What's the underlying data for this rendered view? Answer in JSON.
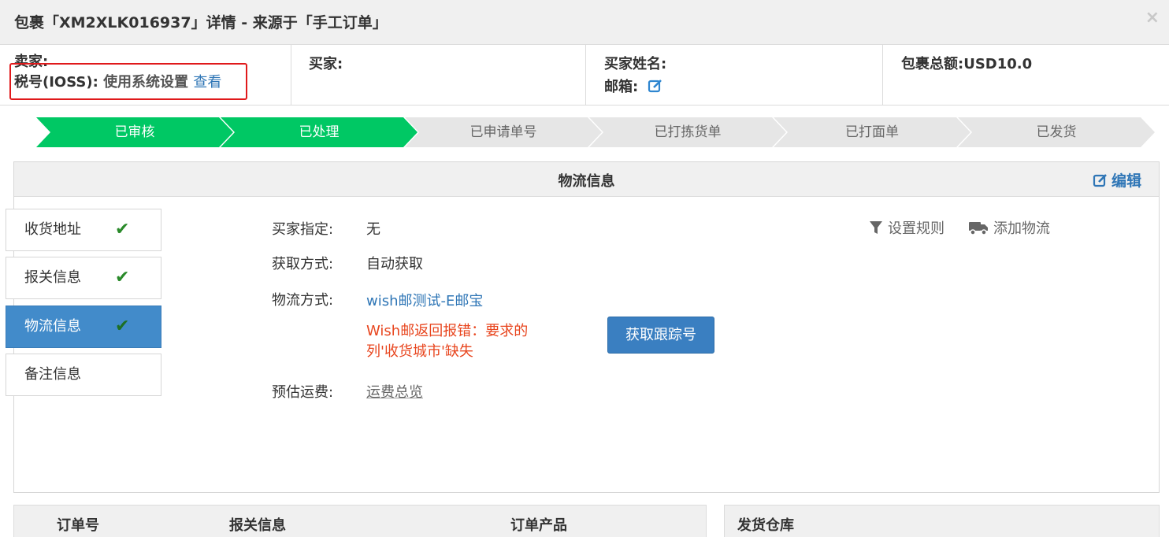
{
  "dialog": {
    "title": "包裹「XM2XLK016937」详情 - 来源于「手工订单」",
    "close_icon": "×"
  },
  "info": {
    "seller_label": "卖家:",
    "ioss_label": "税号(IOSS):",
    "ioss_value": "使用系统设置",
    "ioss_link": "查看",
    "buyer_label": "买家:",
    "buyer_name_label": "买家姓名:",
    "email_label": "邮箱:",
    "total_label": "包裹总额:",
    "total_value": "USD10.0"
  },
  "steps": [
    {
      "label": "已审核",
      "done": true
    },
    {
      "label": "已处理",
      "done": true
    },
    {
      "label": "已申请单号",
      "done": false
    },
    {
      "label": "已打拣货单",
      "done": false
    },
    {
      "label": "已打面单",
      "done": false
    },
    {
      "label": "已发货",
      "done": false
    }
  ],
  "panel": {
    "title": "物流信息",
    "edit_label": "编辑"
  },
  "side_nav": [
    {
      "label": "收货地址",
      "checked": true,
      "active": false
    },
    {
      "label": "报关信息",
      "checked": true,
      "active": false
    },
    {
      "label": "物流信息",
      "checked": true,
      "active": true
    },
    {
      "label": "备注信息",
      "checked": false,
      "active": false
    }
  ],
  "logistics": {
    "buyer_specified_label": "买家指定:",
    "buyer_specified_value": "无",
    "fetch_method_label": "获取方式:",
    "fetch_method_value": "自动获取",
    "shipping_method_label": "物流方式:",
    "shipping_method_value": "wish邮测试-E邮宝",
    "error_message": "Wish邮返回报错：要求的列'收货城市'缺失",
    "track_button": "获取跟踪号",
    "est_fee_label": "预估运费:",
    "est_fee_link": "运费总览",
    "set_rule": "设置规则",
    "add_logistics": "添加物流"
  },
  "bottom": {
    "order_no": "订单号",
    "customs_info": "报关信息",
    "order_products": "订单产品",
    "warehouse": "发货仓库"
  },
  "colors": {
    "step_done": "#00c864",
    "step_todo": "#e6e6e6",
    "active_nav": "#428bca",
    "link": "#2f76b6",
    "error": "#e8461f",
    "highlight_box": "#e0191b"
  }
}
